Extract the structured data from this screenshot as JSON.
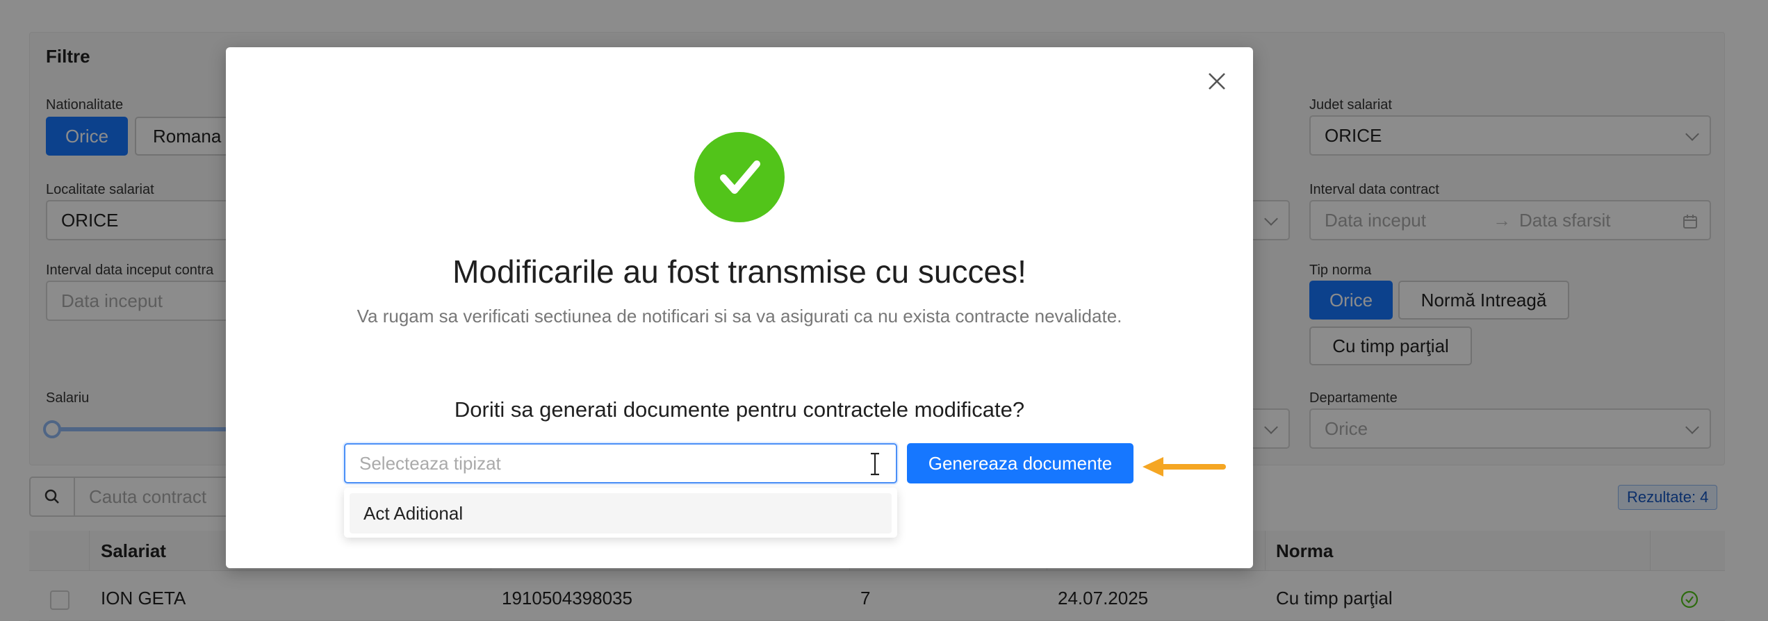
{
  "filters": {
    "title": "Filtre",
    "nationalitate": {
      "label": "Nationalitate",
      "options": [
        "Orice",
        "Romana"
      ]
    },
    "judet_salariat": {
      "label": "Judet salariat",
      "value": "ORICE"
    },
    "localitate_salariat": {
      "label": "Localitate salariat",
      "value": "ORICE"
    },
    "interval_data_contract": {
      "label": "Interval data contract",
      "start_placeholder": "Data inceput",
      "end_placeholder": "Data sfarsit",
      "separator": "→"
    },
    "interval_data_inceput": {
      "label": "Interval data inceput contra",
      "start_placeholder": "Data inceput"
    },
    "tip_norma": {
      "label": "Tip norma",
      "options": [
        "Orice",
        "Normă Intreagă",
        "Cu timp parţial"
      ]
    },
    "salariu": {
      "label": "Salariu"
    },
    "departamente": {
      "label": "Departamente",
      "value": "Orice"
    }
  },
  "search": {
    "placeholder": "Cauta contract"
  },
  "results_badge": "Rezultate: 4",
  "table": {
    "headers": {
      "salariat": "Salariat",
      "norma": "Norma"
    },
    "rows": [
      {
        "salariat": "ION GETA",
        "cnp": "1910504398035",
        "col3": "7",
        "date": "24.07.2025",
        "norma": "Cu timp parţial"
      }
    ]
  },
  "modal": {
    "title": "Modificarile au fost transmise cu succes!",
    "subtitle": "Va rugam sa verificati sectiunea de notificari si sa va asigurati ca nu exista contracte nevalidate.",
    "question": "Doriti sa generati documente pentru contractele modificate?",
    "select_placeholder": "Selecteaza tipizat",
    "generate_label": "Genereaza documente",
    "dropdown_options": [
      "Act Aditional"
    ]
  },
  "colors": {
    "primary": "#1677ff",
    "success": "#52c41a",
    "annotation_arrow": "#f5a623"
  }
}
